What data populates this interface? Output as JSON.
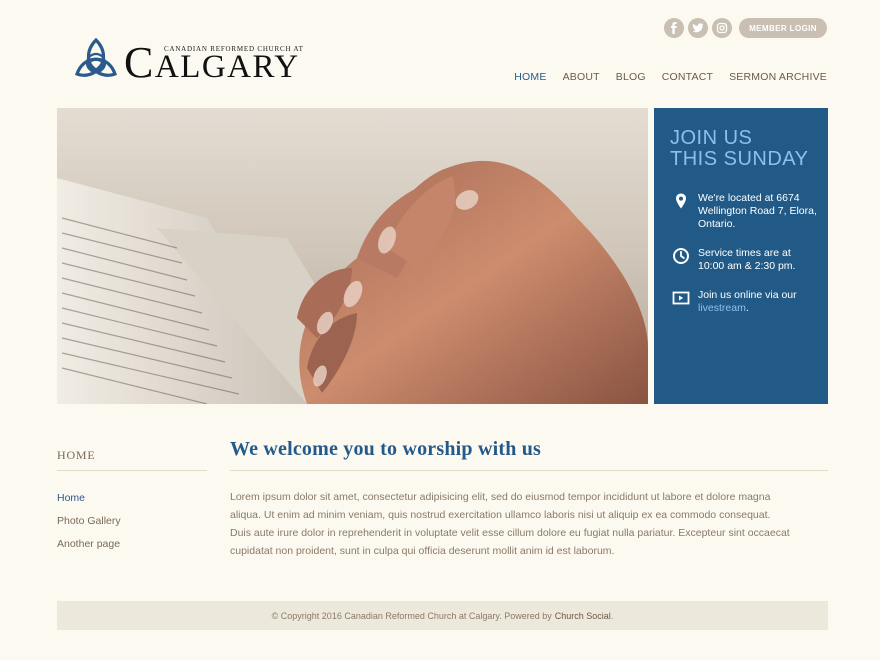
{
  "header": {
    "logo": {
      "small_text": "CANADIAN REFORMED CHURCH AT",
      "big_first": "C",
      "big_rest": "ALGARY"
    },
    "social": [
      {
        "name": "facebook-icon",
        "glyph": "f"
      },
      {
        "name": "twitter-icon",
        "glyph": "t"
      },
      {
        "name": "instagram-icon",
        "glyph": "i"
      }
    ],
    "login_label": "MEMBER LOGIN",
    "nav": [
      {
        "label": "HOME",
        "active": true
      },
      {
        "label": "ABOUT",
        "active": false
      },
      {
        "label": "BLOG",
        "active": false
      },
      {
        "label": "CONTACT",
        "active": false
      },
      {
        "label": "SERMON ARCHIVE",
        "active": false
      }
    ]
  },
  "join": {
    "title_line1": "JOIN US",
    "title_line2": "THIS SUNDAY",
    "location": "We're located at 6674 Wellington Road 7, Elora, Ontario.",
    "times": "Service times are at 10:00 am & 2:30 pm.",
    "online_prefix": "Join us online via our",
    "online_link": "livestream",
    "online_suffix": "."
  },
  "sidebar": {
    "title": "HOME",
    "items": [
      {
        "label": "Home",
        "active": true
      },
      {
        "label": "Photo Gallery",
        "active": false
      },
      {
        "label": "Another page",
        "active": false
      }
    ]
  },
  "main": {
    "title": "We welcome you to worship with us",
    "body": "Lorem ipsum dolor sit amet, consectetur adipisicing elit, sed do eiusmod tempor incididunt ut labore et dolore magna aliqua. Ut enim ad minim veniam, quis nostrud exercitation ullamco laboris nisi ut aliquip ex ea commodo consequat. Duis aute irure dolor in reprehenderit in voluptate velit esse cillum dolore eu fugiat nulla pariatur. Excepteur sint occaecat cupidatat non proident, sunt in culpa qui officia deserunt mollit anim id est laborum."
  },
  "footer": {
    "text": "© Copyright 2016 Canadian Reformed Church at Calgary. Powered by",
    "link": "Church Social",
    "suffix": "."
  }
}
